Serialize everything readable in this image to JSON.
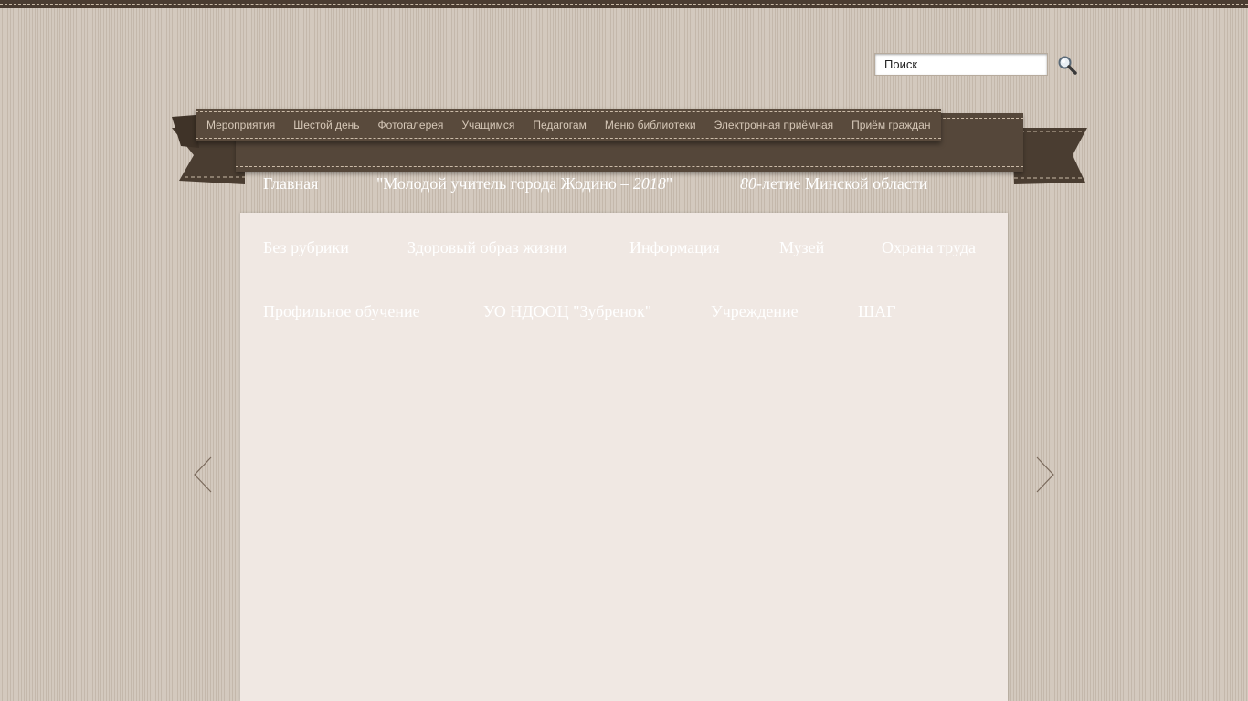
{
  "search": {
    "placeholder": "Поиск",
    "value": "Поиск"
  },
  "topnav": {
    "items": [
      {
        "label": "Мероприятия"
      },
      {
        "label": "Шестой день"
      },
      {
        "label": "Фотогалерея"
      },
      {
        "label": "Учащимся"
      },
      {
        "label": "Педагогам"
      },
      {
        "label": "Меню библиотеки"
      },
      {
        "label": "Электронная приёмная"
      },
      {
        "label": "Приём граждан"
      }
    ]
  },
  "categories": {
    "home": "Главная",
    "young_teacher": {
      "quote_open": "\"",
      "text": "Молодой учитель города Жодино – ",
      "year": "2018",
      "quote_close": "\""
    },
    "minsk": {
      "number": "80-",
      "text": "летие Минской области"
    },
    "no_rubric": "Без рубрики",
    "healthy": "Здоровый образ жизни",
    "info": "Информация",
    "museum": "Музей",
    "labor": "Охрана труда",
    "profile": "Профильное обучение",
    "zubrenok": "УО НДООЦ \"Зубренок\"",
    "institution": "Учреждение",
    "shag": "ШАГ"
  },
  "colors": {
    "ribbon": "#594a3c",
    "panel": "#f0e8e3",
    "background": "#cdc2b6"
  },
  "icons": {
    "search": "magnifier-icon",
    "prev": "chevron-left-icon",
    "next": "chevron-right-icon"
  }
}
